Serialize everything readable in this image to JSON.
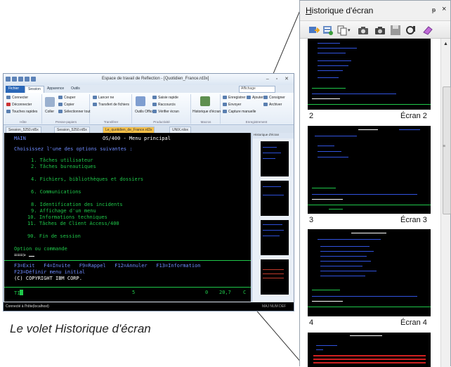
{
  "window": {
    "title": "Espace de travail de Reflection - [Quotidien_France.rd3x]",
    "controls": "– ▫ ✕"
  },
  "ribbon": {
    "tabs": [
      {
        "label": "Fichier",
        "type": "file"
      },
      {
        "label": "Session",
        "type": "active"
      },
      {
        "label": "Apparence",
        "type": "normal"
      },
      {
        "label": "Outils",
        "type": "normal"
      }
    ],
    "search_value": "Affichage",
    "groups": [
      {
        "label": "Hôte",
        "items": [
          "Connecter",
          "Déconnecter",
          "Touches rapides"
        ]
      },
      {
        "label": "Presse-papiers",
        "items": [
          "Couper",
          "Copier",
          "Coller",
          "Sélectionner tout"
        ]
      },
      {
        "label": "Transférer",
        "items": [
          "Lancer ne",
          "Transfert de fichiers"
        ]
      },
      {
        "label": "Productivité",
        "items": [
          "Saisie rapide",
          "Raccourcis",
          "Vérifier écran",
          "Outils Office"
        ]
      },
      {
        "label": "Macros",
        "items": [
          "Historique d'écran"
        ]
      },
      {
        "label": "Enregistrement",
        "items": [
          "Enregistrer",
          "Ajouter",
          "Envoyer",
          "Capture manuelle",
          "Consigner",
          "Archiver"
        ]
      }
    ]
  },
  "doc_tabs": [
    {
      "label": "Session_5250.rd5x",
      "selected": false
    },
    {
      "label": "Session_5250.rd5x",
      "selected": false
    },
    {
      "label": "Le_quotidien_de_France.rd3x",
      "selected": true
    },
    {
      "label": "UNIX.rdox",
      "selected": false
    }
  ],
  "terminal": {
    "header_left": "MAIN",
    "header_center": "OS/400 - Menu principal",
    "prompt": "Choisissez l'une des options suivantes :",
    "options": [
      "1. Tâches utilisateur",
      "2. Tâches bureautiques",
      "4. Fichiers, bibliothèques et dossiers",
      "6. Communications",
      "8. Identification des incidents",
      "9. Affichage d'un menu",
      "10. Informations techniques",
      "11. Tâches de Client Access/400",
      "90. Fin de session"
    ],
    "command_label": "Option ou commande",
    "command_prompt": "===>",
    "fkeys_1": "F3=Exit   F4=Invite   F9=Rappel   F12=Annuler   F13=Information",
    "fkeys_2": "F23=Définir menu initial",
    "copyright": "(C) COPYRIGHT IBM CORP.",
    "oia_left": "TI",
    "oia_mid": "5",
    "oia_right_1": "0",
    "oia_right_2": "20,7",
    "oia_right_3": "C"
  },
  "side_pane": {
    "title": "Historique d'écran"
  },
  "status_bar": {
    "left": "Connecté à l'hôte(localhost)",
    "right": "MAJ NUM DEF"
  },
  "history": {
    "title": "Historique d'écran",
    "title_underline": "H",
    "title_rest": "istorique d'écran",
    "pin": "ᵖ",
    "close": "×",
    "toolbar_icons": [
      "go-to-screen-icon",
      "capture-list-icon",
      "copy-icon",
      "camera-icon",
      "camera-icon",
      "save-icon",
      "settings-icon",
      "clear-icon"
    ],
    "screens": [
      {
        "number": "2",
        "label": "Écran 2"
      },
      {
        "number": "3",
        "label": "Écran 3"
      },
      {
        "number": "4",
        "label": "Écran 4"
      }
    ]
  },
  "caption": "Le volet Historique d'écran",
  "colors": {
    "terminal_green": "#1fc84a",
    "terminal_blue": "#6f8cff",
    "selected_tab": "#f8c24a"
  }
}
